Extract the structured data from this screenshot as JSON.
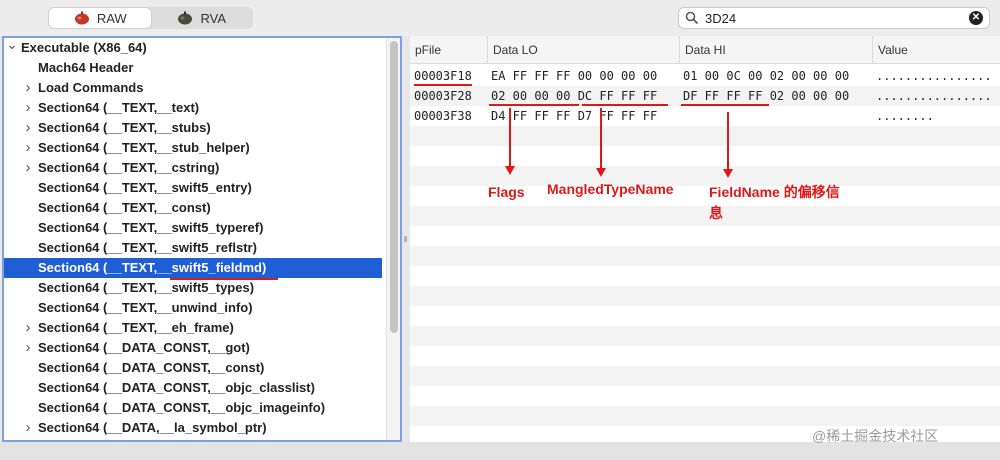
{
  "toolbar": {
    "modes": [
      {
        "label": "RAW",
        "icon": "apple-app-icon",
        "active": true
      },
      {
        "label": "RVA",
        "icon": "apple-app-icon-dark",
        "active": false
      }
    ],
    "search": {
      "value": "3D24",
      "icon": "search-icon",
      "clear_icon": "clear-icon"
    }
  },
  "tree": {
    "items": [
      {
        "label": "Executable  (X86_64)",
        "chevron": "v",
        "level": 0
      },
      {
        "label": "Mach64 Header",
        "chevron": "",
        "level": 1
      },
      {
        "label": "Load Commands",
        "chevron": ">",
        "level": 1
      },
      {
        "label": "Section64 (__TEXT,__text)",
        "chevron": ">",
        "level": 1
      },
      {
        "label": "Section64 (__TEXT,__stubs)",
        "chevron": ">",
        "level": 1
      },
      {
        "label": "Section64 (__TEXT,__stub_helper)",
        "chevron": ">",
        "level": 1
      },
      {
        "label": "Section64 (__TEXT,__cstring)",
        "chevron": ">",
        "level": 1
      },
      {
        "label": "Section64 (__TEXT,__swift5_entry)",
        "chevron": "",
        "level": 1
      },
      {
        "label": "Section64 (__TEXT,__const)",
        "chevron": "",
        "level": 1
      },
      {
        "label": "Section64 (__TEXT,__swift5_typeref)",
        "chevron": "",
        "level": 1
      },
      {
        "label": "Section64 (__TEXT,__swift5_reflstr)",
        "chevron": "",
        "level": 1
      },
      {
        "label": "Section64 (__TEXT,__swift5_fieldmd)",
        "chevron": "",
        "level": 1,
        "selected": true
      },
      {
        "label": "Section64 (__TEXT,__swift5_types)",
        "chevron": "",
        "level": 1
      },
      {
        "label": "Section64 (__TEXT,__unwind_info)",
        "chevron": "",
        "level": 1
      },
      {
        "label": "Section64 (__TEXT,__eh_frame)",
        "chevron": ">",
        "level": 1
      },
      {
        "label": "Section64 (__DATA_CONST,__got)",
        "chevron": ">",
        "level": 1
      },
      {
        "label": "Section64 (__DATA_CONST,__const)",
        "chevron": "",
        "level": 1
      },
      {
        "label": "Section64 (__DATA_CONST,__objc_classlist)",
        "chevron": "",
        "level": 1
      },
      {
        "label": "Section64 (__DATA_CONST,__objc_imageinfo)",
        "chevron": "",
        "level": 1
      },
      {
        "label": "Section64 (__DATA,__la_symbol_ptr)",
        "chevron": ">",
        "level": 1
      }
    ]
  },
  "table": {
    "columns": [
      "pFile",
      "Data LO",
      "Data HI",
      "Value"
    ],
    "rows": [
      {
        "pfile": "00003F18",
        "lo": "EA FF FF FF 00 00 00 00",
        "hi": "01 00 0C 00 02 00 00 00",
        "value": "................"
      },
      {
        "pfile": "00003F28",
        "lo": "02 00 00 00 DC FF FF FF",
        "hi": "DF FF FF FF 02 00 00 00",
        "value": "................"
      },
      {
        "pfile": "00003F38",
        "lo": "D4 FF FF FF D7 FF FF FF",
        "hi": "",
        "value": "........"
      }
    ]
  },
  "annotations": {
    "flags": "Flags",
    "mangled": "MangledTypeName",
    "fieldname_line1": "FieldName 的偏移信",
    "fieldname_line2": "息",
    "color": "#e01818"
  },
  "watermark": "@稀土掘金技术社区",
  "colors": {
    "selection": "#1f5fd6",
    "focus_border": "#7aa0e8",
    "annotation": "#e01818"
  }
}
